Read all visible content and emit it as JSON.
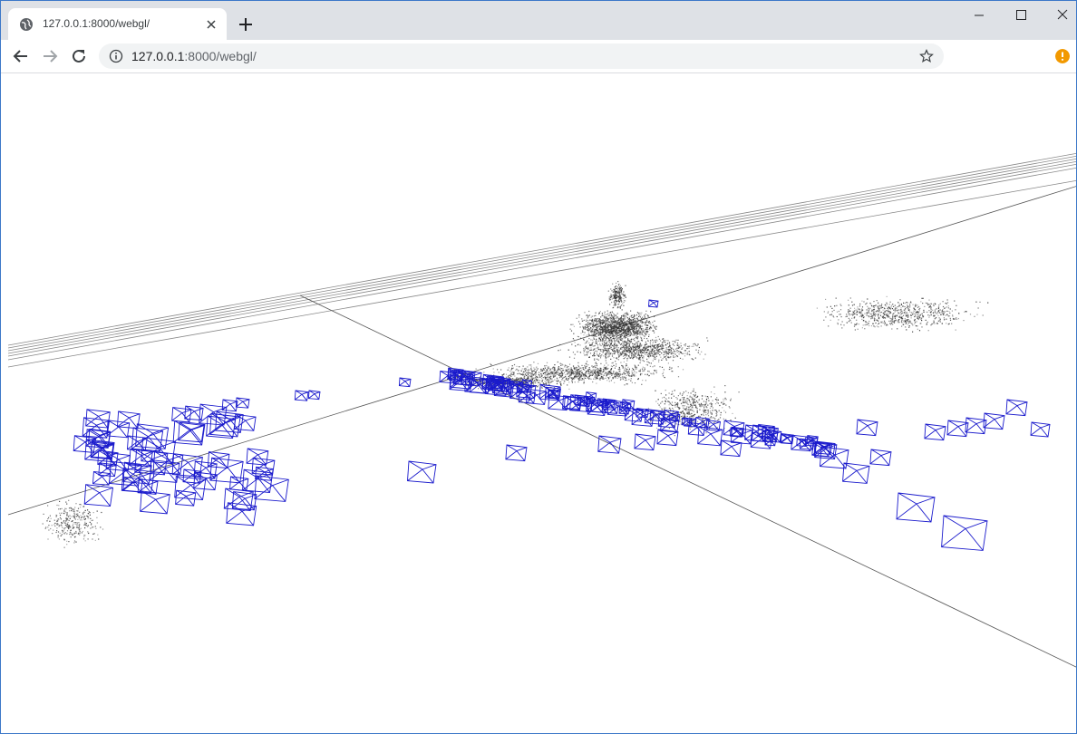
{
  "browser": {
    "tab": {
      "title": "127.0.0.1:8000/webgl/",
      "favicon": "globe-icon"
    },
    "toolbar": {
      "url_host": "127.0.0.1",
      "url_path": ":8000/webgl/",
      "icons": [
        "back-arrow-icon",
        "forward-arrow-icon",
        "reload-icon",
        "info-icon",
        "star-icon",
        "alert-icon"
      ]
    },
    "window_controls": [
      "minimize-icon",
      "maximize-icon",
      "close-icon"
    ]
  },
  "scene": {
    "description_type": "webgl-3d-point-cloud",
    "colors": {
      "background": "#ffffff",
      "points": "#333333",
      "cameras": "#1a1acc",
      "grid_lines": "#555555",
      "alert": "#f29900"
    }
  }
}
